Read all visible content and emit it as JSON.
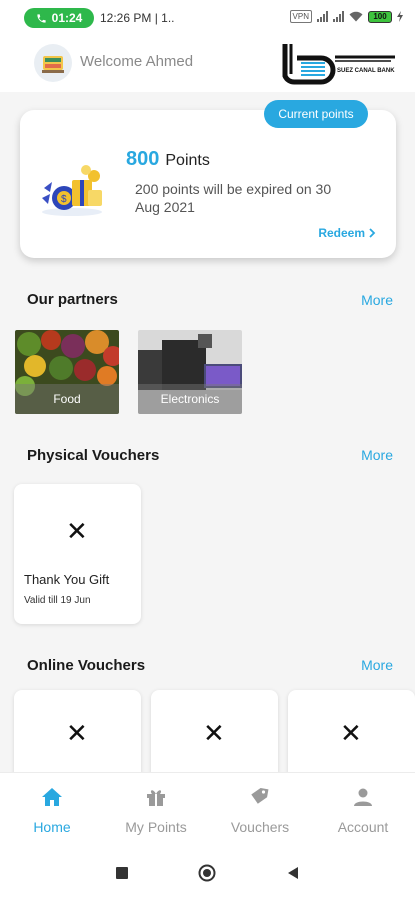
{
  "status_bar": {
    "call_time": "01:24",
    "time": "12:26 PM | 1..",
    "vpn": "VPN",
    "battery": "100"
  },
  "header": {
    "welcome_text": "Welcome Ahmed",
    "logo_text": "SUEZ CANAL BANK"
  },
  "points_card": {
    "badge": "Current points",
    "points_value": "800",
    "points_label": "Points",
    "expiry_text": "200 points will be expired on 30 Aug 2021",
    "redeem_label": "Redeem"
  },
  "partners": {
    "title": "Our partners",
    "more": "More",
    "items": [
      {
        "label": "Food"
      },
      {
        "label": "Electronics"
      }
    ]
  },
  "physical_vouchers": {
    "title": "Physical Vouchers",
    "more": "More",
    "items": [
      {
        "title": "Thank You Gift",
        "valid": "Valid till 19 Jun"
      }
    ]
  },
  "online_vouchers": {
    "title": "Online Vouchers",
    "more": "More"
  },
  "bottom_nav": {
    "items": [
      {
        "label": "Home",
        "icon": "home-icon",
        "active": true
      },
      {
        "label": "My Points",
        "icon": "gift-icon",
        "active": false
      },
      {
        "label": "Vouchers",
        "icon": "voucher-icon",
        "active": false
      },
      {
        "label": "Account",
        "icon": "account-icon",
        "active": false
      }
    ]
  },
  "colors": {
    "accent": "#29a8e0",
    "call_green": "#2eb84b"
  }
}
